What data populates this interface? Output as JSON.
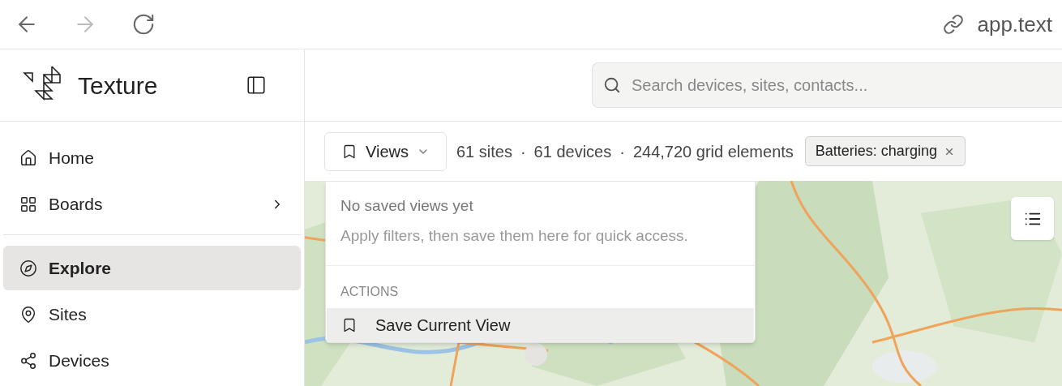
{
  "browser": {
    "nav_buttons": [
      {
        "kind": "back",
        "disabled": false
      },
      {
        "kind": "forward",
        "disabled": true
      },
      {
        "kind": "reload",
        "disabled": false
      }
    ],
    "url": "app.text"
  },
  "sidebar": {
    "brand": "Texture",
    "sections": [
      [
        {
          "label": "Home",
          "selected": false,
          "submenu": false
        },
        {
          "label": "Boards",
          "selected": false,
          "submenu": true
        }
      ],
      [
        {
          "label": "Explore",
          "selected": true,
          "submenu": false
        },
        {
          "label": "Sites",
          "selected": false,
          "submenu": false
        },
        {
          "label": "Devices",
          "selected": false,
          "submenu": false
        }
      ]
    ]
  },
  "search": {
    "placeholder": "Search devices, sites, contacts..."
  },
  "toolbar": {
    "views_button": "Views",
    "separator": "·",
    "counts": [
      "61 sites",
      "61 devices",
      "244,720 grid elements"
    ],
    "filter_chips": [
      {
        "label": "Batteries: charging"
      }
    ]
  },
  "views_menu": {
    "empty_title": "No saved views yet",
    "empty_hint": "Apply filters, then save them here for quick access.",
    "section_label": "ACTIONS",
    "actions": [
      {
        "label": "Save Current View",
        "highlighted": true
      }
    ]
  }
}
